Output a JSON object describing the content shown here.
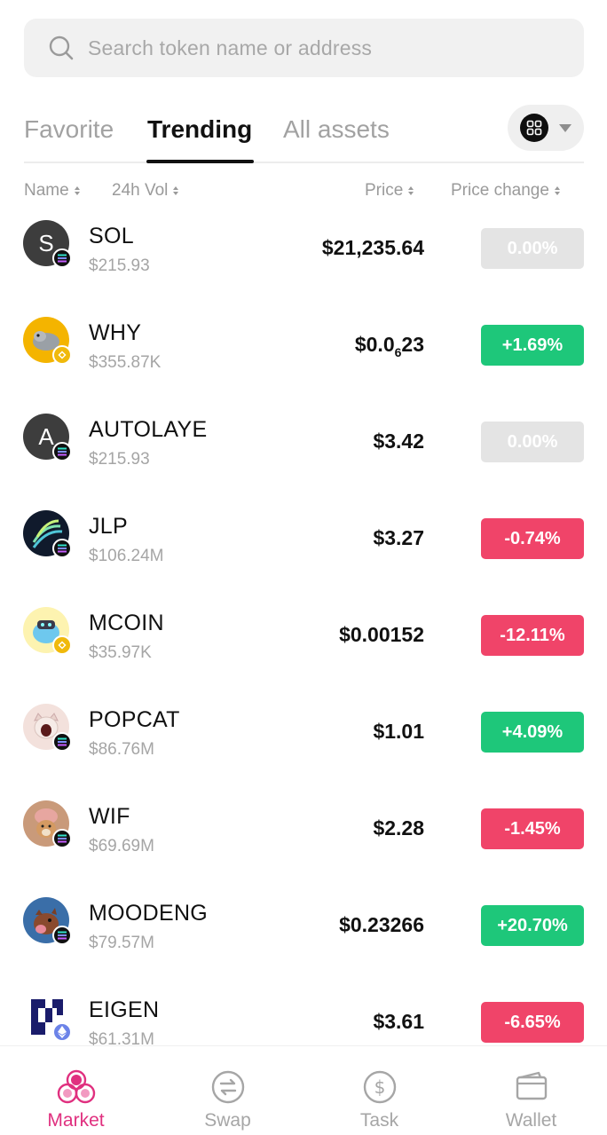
{
  "search": {
    "placeholder": "Search token name or address",
    "icon": "search-icon"
  },
  "tabs": [
    {
      "label": "Favorite",
      "active": false
    },
    {
      "label": "Trending",
      "active": true
    },
    {
      "label": "All assets",
      "active": false
    }
  ],
  "columns": {
    "name": "Name",
    "volume": "24h Vol",
    "price": "Price",
    "change": "Price change"
  },
  "tokens": [
    {
      "symbol": "SOL",
      "volume": "$215.93",
      "price": "$21,235.64",
      "change": "0.00%",
      "trend": "flat",
      "chain": "solana",
      "avatar_letter": "S",
      "avatar_color": "#3d3d3d"
    },
    {
      "symbol": "WHY",
      "volume": "$355.87K",
      "price_prefix": "$0.0",
      "price_sub": "6",
      "price_suffix": "23",
      "change": "+1.69%",
      "trend": "up",
      "chain": "bnb",
      "avatar_color": "#f4b400"
    },
    {
      "symbol": "AUTOLAYE",
      "volume": "$215.93",
      "price": "$3.42",
      "change": "0.00%",
      "trend": "flat",
      "chain": "solana",
      "avatar_letter": "A",
      "avatar_color": "#3d3d3d"
    },
    {
      "symbol": "JLP",
      "volume": "$106.24M",
      "price": "$3.27",
      "change": "-0.74%",
      "trend": "down",
      "chain": "solana",
      "avatar_color": "#101a2c"
    },
    {
      "symbol": "MCOIN",
      "volume": "$35.97K",
      "price": "$0.00152",
      "change": "-12.11%",
      "trend": "down",
      "chain": "bnb",
      "avatar_color": "#fdf3b0"
    },
    {
      "symbol": "POPCAT",
      "volume": "$86.76M",
      "price": "$1.01",
      "change": "+4.09%",
      "trend": "up",
      "chain": "solana",
      "avatar_color": "#f3e1dc"
    },
    {
      "symbol": "WIF",
      "volume": "$69.69M",
      "price": "$2.28",
      "change": "-1.45%",
      "trend": "down",
      "chain": "solana",
      "avatar_color": "#c99a7a"
    },
    {
      "symbol": "MOODENG",
      "volume": "$79.57M",
      "price": "$0.23266",
      "change": "+20.70%",
      "trend": "up",
      "chain": "solana",
      "avatar_color": "#3a6ea8"
    },
    {
      "symbol": "EIGEN",
      "volume": "$61.31M",
      "price": "$3.61",
      "change": "-6.65%",
      "trend": "down",
      "chain": "ethereum",
      "avatar_color": "#1a1c6b"
    }
  ],
  "colors": {
    "up": "#1ec77a",
    "down": "#f04469",
    "flat": "#e4e4e4",
    "accent": "#e0307f"
  },
  "nav": [
    {
      "label": "Market",
      "icon": "market-icon",
      "active": true
    },
    {
      "label": "Swap",
      "icon": "swap-icon",
      "active": false
    },
    {
      "label": "Task",
      "icon": "task-icon",
      "active": false
    },
    {
      "label": "Wallet",
      "icon": "wallet-icon",
      "active": false
    }
  ]
}
